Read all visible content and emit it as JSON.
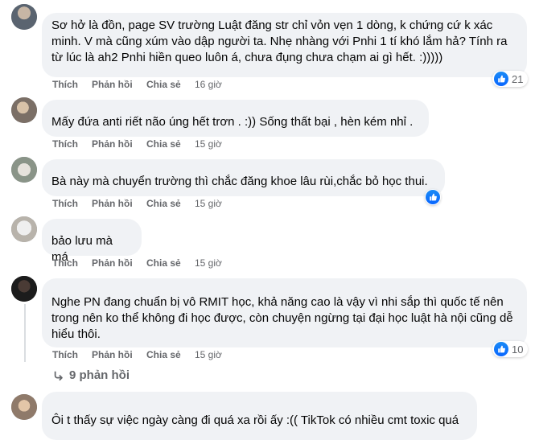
{
  "actions": {
    "like": "Thích",
    "reply": "Phản hồi",
    "share": "Chia sẻ"
  },
  "comments": [
    {
      "text": "Sơ hở là đồn, page SV trường Luật đăng str chỉ vỏn vẹn 1 dòng, k chứng cứ k xác minh. V mà cũng xúm vào dập người ta. Nhẹ nhàng với Pnhi 1 tí khó lắm hả? Tính ra từ lúc là ah2 Pnhi hiền queo luôn á, chưa đụng chưa chạm ai gì hết. :)))))",
      "time": "16 giờ",
      "reactions": "21"
    },
    {
      "text": "Mấy đứa anti riết não úng hết trơn . :)) Sống thất bại , hèn kém nhỉ .",
      "time": "15 giờ"
    },
    {
      "text": "Bà này mà chuyển trường thì chắc đăng khoe lâu rùi,chắc bỏ học thui.",
      "time": "15 giờ",
      "reactions": ""
    },
    {
      "text": "bảo lưu mà má",
      "time": "15 giờ"
    },
    {
      "text": "Nghe PN đang chuẩn bị vô RMIT học, khả năng cao là vậy vì nhi sắp thì quốc tế nên trong nên ko thể không đi học được, còn chuyện ngừng tại đại học luật hà nội cũng dễ hiểu thôi.",
      "time": "15 giờ",
      "reactions": "10",
      "replies": "9 phản hồi"
    },
    {
      "text": "Ôi t thấy sự việc ngày càng đi quá xa rồi ấy :(( TikTok có nhiều cmt toxic quá"
    }
  ],
  "colors": {
    "like_blue": "#0866ff",
    "bubble": "#f0f2f5",
    "meta_gray": "#65676b"
  }
}
